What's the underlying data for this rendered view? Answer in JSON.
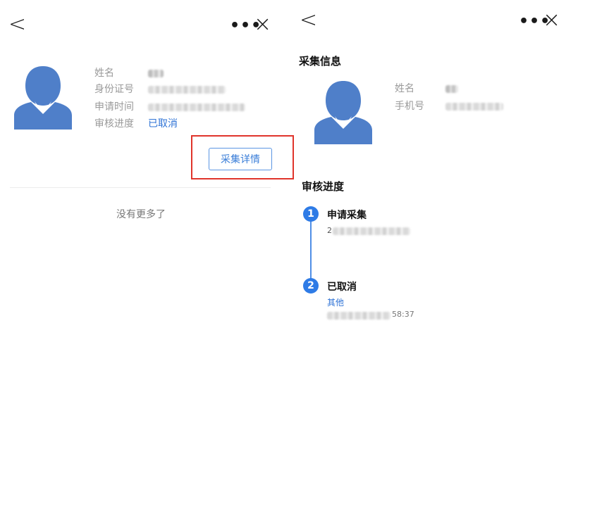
{
  "left": {
    "nav": {
      "back": "<",
      "more": "•••",
      "close": "×"
    },
    "profile": {
      "labels": [
        "姓名",
        "身份证号",
        "申请时间",
        "审核进度"
      ],
      "status": "已取消"
    },
    "detail_button": "采集详情",
    "footer": "没有更多了"
  },
  "right": {
    "nav": {
      "back": "<",
      "more": "•••",
      "close": "×"
    },
    "collect_title": "采集信息",
    "profile": {
      "labels": [
        "姓名",
        "手机号"
      ]
    },
    "progress_title": "审核进度",
    "steps": [
      {
        "num": "1",
        "title": "申请采集",
        "value_prefix": "2"
      },
      {
        "num": "2",
        "title": "已取消",
        "reason": "其他",
        "value_suffix": "58:37"
      }
    ]
  },
  "colors": {
    "avatar": "#4f7fc9",
    "accent": "#2e7be6",
    "highlight": "#e0342b"
  }
}
